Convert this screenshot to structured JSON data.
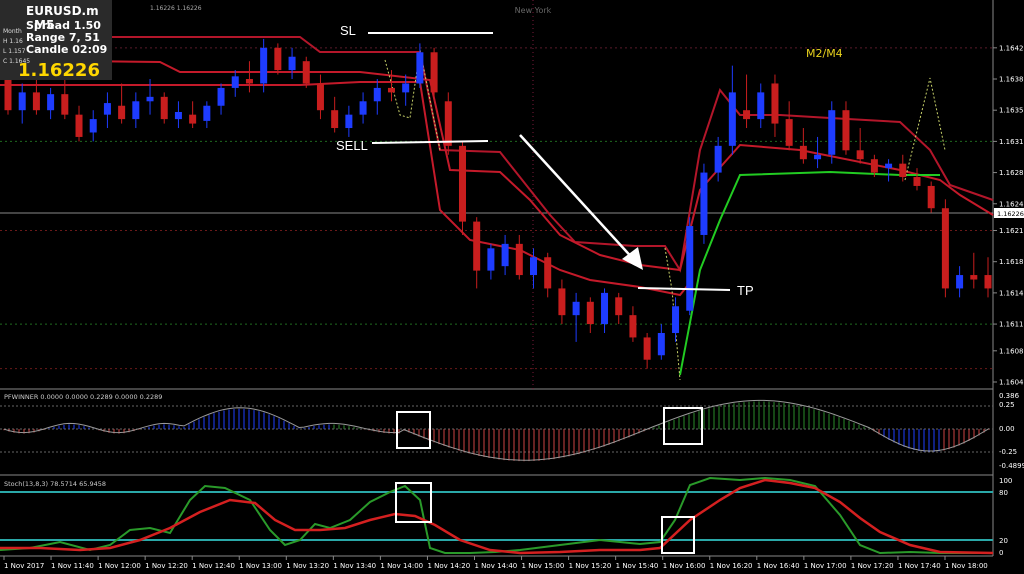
{
  "info_panel": {
    "symbol": "EURUSD.m",
    "timeframe": "M5",
    "spread": "Spread 1.50",
    "range": "Range 7, 51",
    "candle": "Candle 02:09",
    "price": "1.16226",
    "mini_lines": [
      "Month",
      "H 1.16",
      "L 1.157",
      "C 1.1645"
    ]
  },
  "header_quote": "1.16226 1.16226",
  "session_label": "New York",
  "indicator_label": "M2/M4",
  "annotations": {
    "sl": "SL",
    "sell": "SELL",
    "tp": "TP"
  },
  "price_axis": {
    "ticks": [
      "1.16420",
      "1.16385",
      "1.16350",
      "1.16315",
      "1.16280",
      "1.16245",
      "1.16215",
      "1.16180",
      "1.16145",
      "1.16110",
      "1.16080",
      "1.16045"
    ],
    "current_price": "1.16226"
  },
  "pfwinner": {
    "title": "PFWINNER 0.0000 0.0000 0.2289 0.0000 0.2289",
    "ticks": [
      "0.386",
      "0.25",
      "0.00",
      "-0.25",
      "-0.4899"
    ]
  },
  "stoch": {
    "title": "Stoch(13,8,3) 78.5714 65.9458",
    "ticks": [
      "100",
      "80",
      "20",
      "0"
    ]
  },
  "time_axis": [
    "1 Nov 2017",
    "1 Nov 11:40",
    "1 Nov 12:00",
    "1 Nov 12:20",
    "1 Nov 12:40",
    "1 Nov 13:00",
    "1 Nov 13:20",
    "1 Nov 13:40",
    "1 Nov 14:00",
    "1 Nov 14:20",
    "1 Nov 14:40",
    "1 Nov 15:00",
    "1 Nov 15:20",
    "1 Nov 15:40",
    "1 Nov 16:00",
    "1 Nov 16:20",
    "1 Nov 16:40",
    "1 Nov 17:00",
    "1 Nov 17:20",
    "1 Nov 17:40",
    "1 Nov 18:00"
  ],
  "chart_data": {
    "type": "candlestick",
    "symbol": "EURUSD.m",
    "timeframe": "M5",
    "ylim": [
      1.16045,
      1.1644
    ],
    "candles": [
      [
        1.1639,
        1.16395,
        1.16345,
        1.1635
      ],
      [
        1.1635,
        1.1638,
        1.16335,
        1.1637
      ],
      [
        1.1637,
        1.1639,
        1.16345,
        1.1635
      ],
      [
        1.1635,
        1.16375,
        1.1634,
        1.16368
      ],
      [
        1.16368,
        1.16385,
        1.1634,
        1.16345
      ],
      [
        1.16345,
        1.16355,
        1.16315,
        1.1632
      ],
      [
        1.16325,
        1.1635,
        1.16315,
        1.1634
      ],
      [
        1.16345,
        1.1637,
        1.1633,
        1.16358
      ],
      [
        1.16355,
        1.1638,
        1.16335,
        1.1634
      ],
      [
        1.1634,
        1.1637,
        1.1633,
        1.1636
      ],
      [
        1.1636,
        1.16385,
        1.16345,
        1.16365
      ],
      [
        1.16365,
        1.1637,
        1.16335,
        1.1634
      ],
      [
        1.1634,
        1.1636,
        1.1633,
        1.16348
      ],
      [
        1.16345,
        1.1636,
        1.1633,
        1.16335
      ],
      [
        1.16338,
        1.1636,
        1.1633,
        1.16355
      ],
      [
        1.16355,
        1.1638,
        1.16345,
        1.16375
      ],
      [
        1.16375,
        1.16395,
        1.16365,
        1.16388
      ],
      [
        1.16385,
        1.16405,
        1.1637,
        1.1638
      ],
      [
        1.1638,
        1.1643,
        1.1637,
        1.1642
      ],
      [
        1.1642,
        1.16425,
        1.1639,
        1.16395
      ],
      [
        1.16395,
        1.1642,
        1.16385,
        1.1641
      ],
      [
        1.16405,
        1.1641,
        1.16375,
        1.1638
      ],
      [
        1.1638,
        1.1639,
        1.1634,
        1.1635
      ],
      [
        1.1635,
        1.16365,
        1.16325,
        1.1633
      ],
      [
        1.1633,
        1.16355,
        1.1632,
        1.16345
      ],
      [
        1.16345,
        1.1637,
        1.16335,
        1.1636
      ],
      [
        1.1636,
        1.16385,
        1.16345,
        1.16375
      ],
      [
        1.16375,
        1.16395,
        1.1636,
        1.1637
      ],
      [
        1.1637,
        1.1639,
        1.16355,
        1.1638
      ],
      [
        1.1638,
        1.16425,
        1.16375,
        1.16415
      ],
      [
        1.16415,
        1.1642,
        1.16365,
        1.1637
      ],
      [
        1.1636,
        1.1637,
        1.163,
        1.1631
      ],
      [
        1.1631,
        1.16315,
        1.1621,
        1.16225
      ],
      [
        1.16225,
        1.1623,
        1.1615,
        1.1617
      ],
      [
        1.1617,
        1.162,
        1.1616,
        1.16195
      ],
      [
        1.16175,
        1.1621,
        1.16165,
        1.162
      ],
      [
        1.162,
        1.1621,
        1.1616,
        1.16165
      ],
      [
        1.16165,
        1.16195,
        1.1615,
        1.16185
      ],
      [
        1.16185,
        1.1619,
        1.1614,
        1.1615
      ],
      [
        1.1615,
        1.1616,
        1.1611,
        1.1612
      ],
      [
        1.1612,
        1.16145,
        1.1609,
        1.16135
      ],
      [
        1.16135,
        1.1614,
        1.161,
        1.1611
      ],
      [
        1.1611,
        1.1615,
        1.161,
        1.16145
      ],
      [
        1.1614,
        1.16145,
        1.1611,
        1.1612
      ],
      [
        1.1612,
        1.1613,
        1.1609,
        1.16095
      ],
      [
        1.16095,
        1.161,
        1.1606,
        1.1607
      ],
      [
        1.16075,
        1.1611,
        1.1607,
        1.161
      ],
      [
        1.161,
        1.1614,
        1.1609,
        1.1613
      ],
      [
        1.16125,
        1.1623,
        1.1612,
        1.1622
      ],
      [
        1.1621,
        1.1629,
        1.162,
        1.1628
      ],
      [
        1.1628,
        1.1632,
        1.1627,
        1.1631
      ],
      [
        1.1631,
        1.164,
        1.163,
        1.1637
      ],
      [
        1.1635,
        1.1639,
        1.1633,
        1.1634
      ],
      [
        1.1634,
        1.1638,
        1.1633,
        1.1637
      ],
      [
        1.1638,
        1.1639,
        1.1632,
        1.16335
      ],
      [
        1.1634,
        1.1636,
        1.16305,
        1.1631
      ],
      [
        1.1631,
        1.1633,
        1.1629,
        1.16295
      ],
      [
        1.16295,
        1.1632,
        1.16285,
        1.163
      ],
      [
        1.163,
        1.1636,
        1.1629,
        1.1635
      ],
      [
        1.1635,
        1.1636,
        1.163,
        1.16305
      ],
      [
        1.16305,
        1.1633,
        1.1629,
        1.16295
      ],
      [
        1.16295,
        1.163,
        1.16275,
        1.1628
      ],
      [
        1.16285,
        1.16295,
        1.1627,
        1.1629
      ],
      [
        1.1629,
        1.163,
        1.1627,
        1.16275
      ],
      [
        1.16275,
        1.16285,
        1.1626,
        1.16265
      ],
      [
        1.16265,
        1.1627,
        1.16235,
        1.1624
      ],
      [
        1.1624,
        1.1625,
        1.1614,
        1.1615
      ],
      [
        1.1615,
        1.16175,
        1.1614,
        1.16165
      ],
      [
        1.16165,
        1.1619,
        1.1615,
        1.1616
      ],
      [
        1.16165,
        1.16185,
        1.1614,
        1.1615
      ]
    ],
    "levels": {
      "sl": 1.1641,
      "sell": 1.163,
      "tp": 1.16145
    }
  }
}
